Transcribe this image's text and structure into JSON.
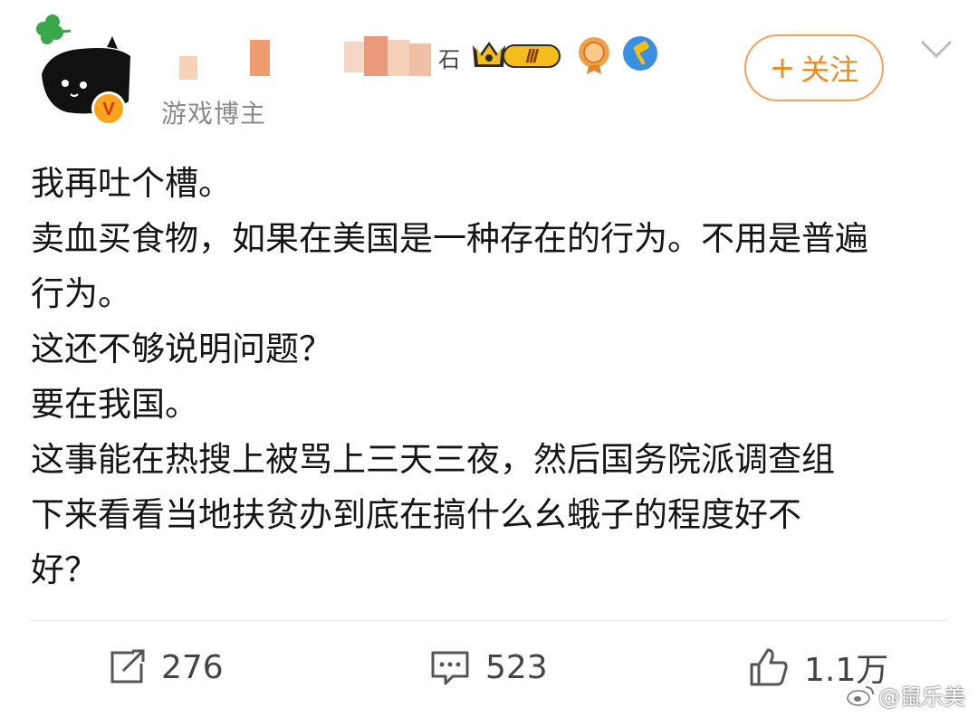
{
  "header": {
    "role": "游戏博主",
    "verified_mark": "V",
    "level_badge": "Ⅲ",
    "follow_label": "关注",
    "follow_plus": "+",
    "name_tail": "石"
  },
  "post": {
    "lines": [
      "我再吐个槽。",
      "卖血买食物，如果在美国是一种存在的行为。不用是普遍",
      "行为。",
      "这还不够说明问题？",
      "要在我国。",
      "这事能在热搜上被骂上三天三夜，然后国务院派调查组",
      "下来看看当地扶贫办到底在搞什么幺蛾子的程度好不",
      "好？"
    ]
  },
  "actions": {
    "repost_count": "276",
    "comment_count": "523",
    "like_count": "1.1万"
  },
  "watermark": "@鼠乐美",
  "colors": {
    "accent": "#f08a24",
    "verified": "#f7a51c",
    "text": "#151515",
    "muted": "#8a8a8a"
  },
  "icons": [
    "clover-icon",
    "avatar-image",
    "verified-icon",
    "crown-icon",
    "level-badge-icon",
    "medal-icon",
    "hammer-badge-icon",
    "chevron-down-icon",
    "repost-icon",
    "comment-icon",
    "like-icon",
    "weibo-logo-icon"
  ]
}
